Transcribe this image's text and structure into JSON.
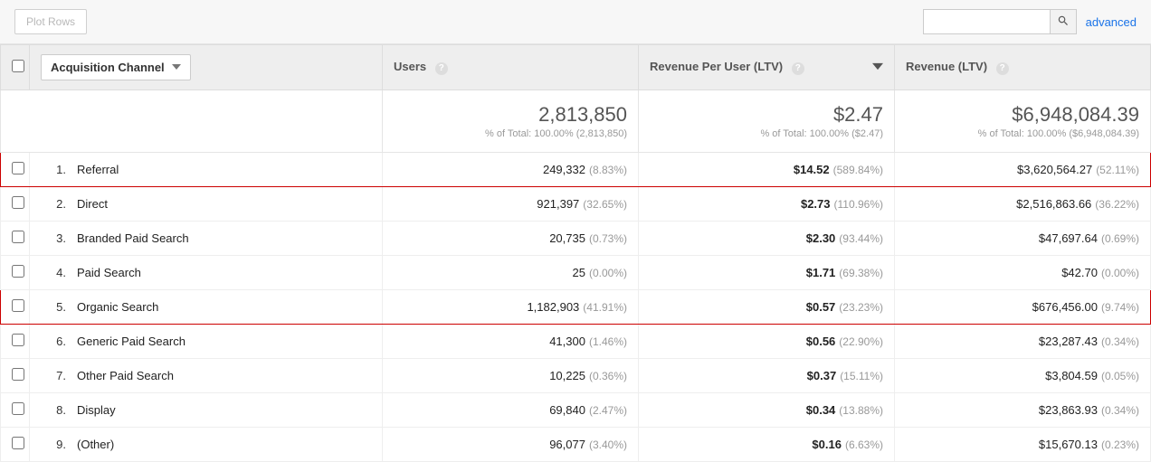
{
  "toolbar": {
    "plot_rows_label": "Plot Rows",
    "advanced_label": "advanced",
    "search_placeholder": ""
  },
  "table": {
    "dimension_label": "Acquisition Channel",
    "columns": [
      {
        "label": "Users"
      },
      {
        "label": "Revenue Per User (LTV)",
        "sorted_desc": true
      },
      {
        "label": "Revenue (LTV)"
      }
    ],
    "summary": {
      "users": {
        "value": "2,813,850",
        "sub": "% of Total: 100.00% (2,813,850)"
      },
      "rpu": {
        "value": "$2.47",
        "sub": "% of Total: 100.00% ($2.47)"
      },
      "rev": {
        "value": "$6,948,084.39",
        "sub": "% of Total: 100.00% ($6,948,084.39)"
      }
    },
    "rows": [
      {
        "rank": "1.",
        "name": "Referral",
        "users_val": "249,332",
        "users_pct": "(8.83%)",
        "rpu_val": "$14.52",
        "rpu_pct": "(589.84%)",
        "rev_val": "$3,620,564.27",
        "rev_pct": "(52.11%)",
        "highlight": true
      },
      {
        "rank": "2.",
        "name": "Direct",
        "users_val": "921,397",
        "users_pct": "(32.65%)",
        "rpu_val": "$2.73",
        "rpu_pct": "(110.96%)",
        "rev_val": "$2,516,863.66",
        "rev_pct": "(36.22%)"
      },
      {
        "rank": "3.",
        "name": "Branded Paid Search",
        "users_val": "20,735",
        "users_pct": "(0.73%)",
        "rpu_val": "$2.30",
        "rpu_pct": "(93.44%)",
        "rev_val": "$47,697.64",
        "rev_pct": "(0.69%)"
      },
      {
        "rank": "4.",
        "name": "Paid Search",
        "users_val": "25",
        "users_pct": "(0.00%)",
        "rpu_val": "$1.71",
        "rpu_pct": "(69.38%)",
        "rev_val": "$42.70",
        "rev_pct": "(0.00%)"
      },
      {
        "rank": "5.",
        "name": "Organic Search",
        "users_val": "1,182,903",
        "users_pct": "(41.91%)",
        "rpu_val": "$0.57",
        "rpu_pct": "(23.23%)",
        "rev_val": "$676,456.00",
        "rev_pct": "(9.74%)",
        "highlight": true
      },
      {
        "rank": "6.",
        "name": "Generic Paid Search",
        "users_val": "41,300",
        "users_pct": "(1.46%)",
        "rpu_val": "$0.56",
        "rpu_pct": "(22.90%)",
        "rev_val": "$23,287.43",
        "rev_pct": "(0.34%)"
      },
      {
        "rank": "7.",
        "name": "Other Paid Search",
        "users_val": "10,225",
        "users_pct": "(0.36%)",
        "rpu_val": "$0.37",
        "rpu_pct": "(15.11%)",
        "rev_val": "$3,804.59",
        "rev_pct": "(0.05%)"
      },
      {
        "rank": "8.",
        "name": "Display",
        "users_val": "69,840",
        "users_pct": "(2.47%)",
        "rpu_val": "$0.34",
        "rpu_pct": "(13.88%)",
        "rev_val": "$23,863.93",
        "rev_pct": "(0.34%)"
      },
      {
        "rank": "9.",
        "name": "(Other)",
        "users_val": "96,077",
        "users_pct": "(3.40%)",
        "rpu_val": "$0.16",
        "rpu_pct": "(6.63%)",
        "rev_val": "$15,670.13",
        "rev_pct": "(0.23%)"
      }
    ]
  }
}
